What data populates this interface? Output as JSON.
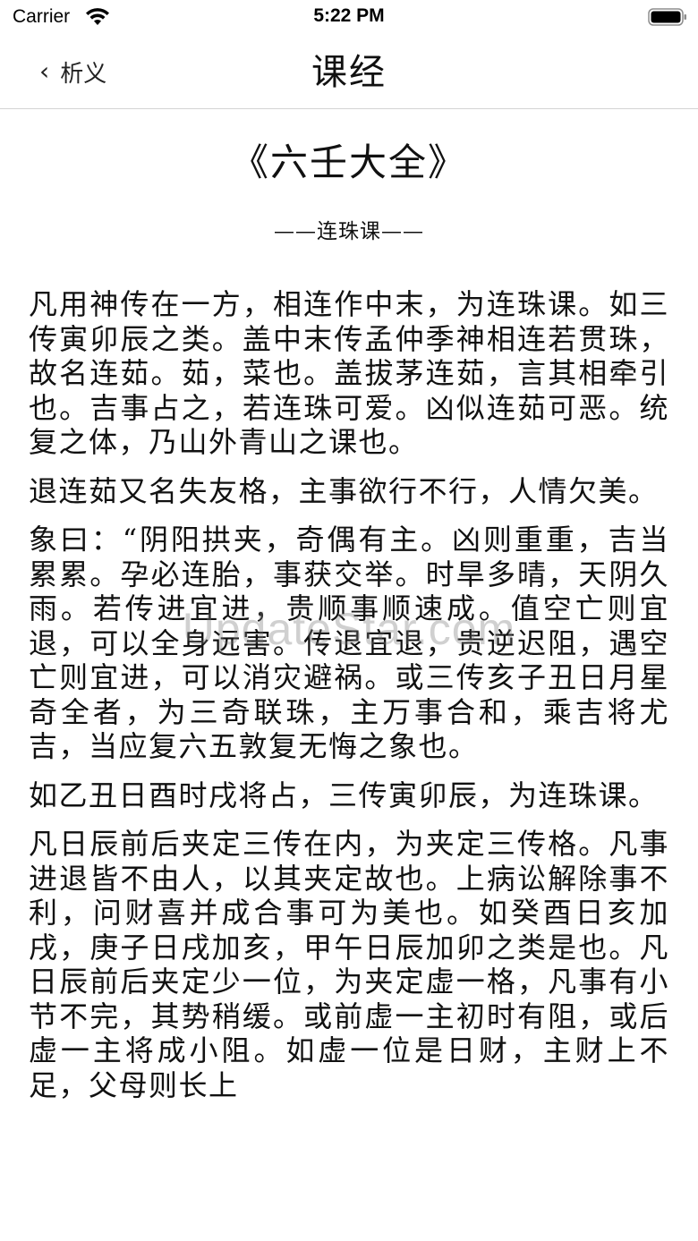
{
  "status_bar": {
    "carrier": "Carrier",
    "time": "5:22 PM",
    "wifi_icon": "wifi-icon",
    "battery_icon": "battery-icon"
  },
  "nav": {
    "back_label": "析义",
    "back_icon": "chevron-left-icon",
    "title": "课经"
  },
  "article": {
    "book_title": "《六壬大全》",
    "subtitle": "——连珠课——",
    "paragraphs": [
      "凡用神传在一方，相连作中末，为连珠课。如三传寅卯辰之类。盖中末传孟仲季神相连若贯珠，故名连茹。茹，菜也。盖拔茅连茹，言其相牵引也。吉事占之，若连珠可爱。凶似连茹可恶。统复之体，乃山外青山之课也。",
      "退连茹又名失友格，主事欲行不行，人情欠美。",
      "象曰：“阴阳拱夹，奇偶有主。凶则重重，吉当累累。孕必连胎，事获交举。时旱多晴，天阴久雨。若传进宜进，贵顺事顺速成。值空亡则宜退，可以全身远害。传退宜退，贵逆迟阻，遇空亡则宜进，可以消灾避祸。或三传亥子丑日月星奇全者，为三奇联珠，主万事合和，乘吉将尤吉，当应复六五敦复无悔之象也。",
      "如乙丑日酉时戌将占，三传寅卯辰，为连珠课。",
      "凡日辰前后夹定三传在内，为夹定三传格。凡事进退皆不由人，以其夹定故也。上病讼解除事不利，问财喜并成合事可为美也。如癸酉日亥加戌，庚子日戌加亥，甲午日辰加卯之类是也。凡日辰前后夹定少一位，为夹定虚一格，凡事有小节不完，其势稍缓。或前虚一主初时有阻，或后虚一主将成小阻。如虚一位是日财，主财上不足，父母则长上"
    ]
  },
  "watermark": "UpdateStar.com",
  "colors": {
    "text": "#111111",
    "background": "#ffffff",
    "divider": "#d4d4d4"
  }
}
